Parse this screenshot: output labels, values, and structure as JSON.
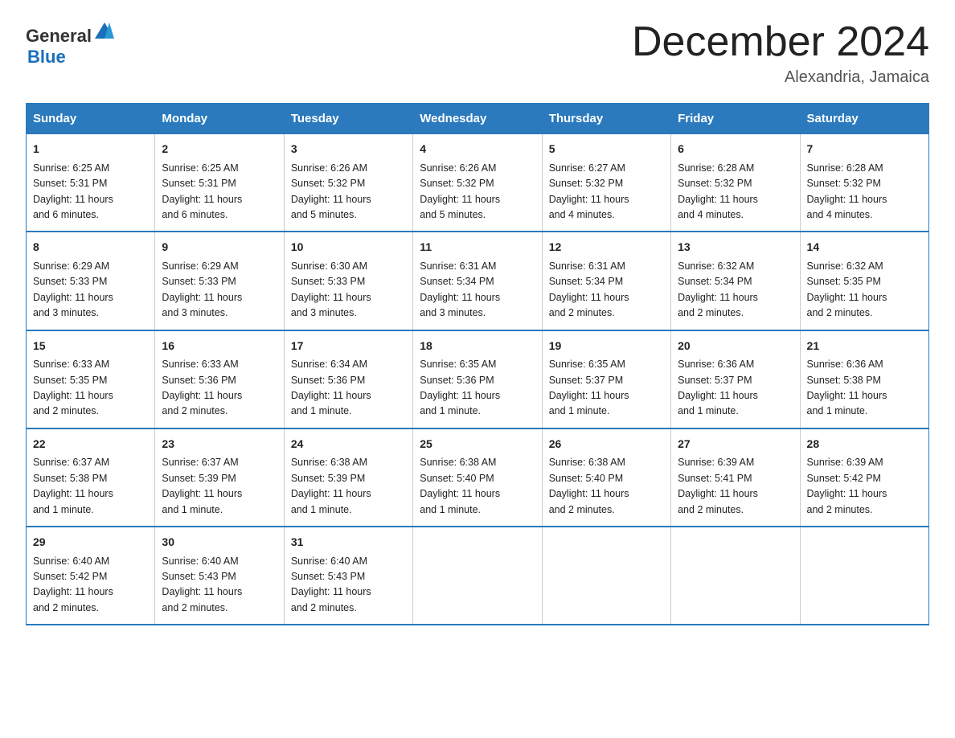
{
  "logo": {
    "text_general": "General",
    "text_blue": "Blue"
  },
  "header": {
    "month_year": "December 2024",
    "location": "Alexandria, Jamaica"
  },
  "days_of_week": [
    "Sunday",
    "Monday",
    "Tuesday",
    "Wednesday",
    "Thursday",
    "Friday",
    "Saturday"
  ],
  "weeks": [
    [
      {
        "day": "1",
        "sunrise": "6:25 AM",
        "sunset": "5:31 PM",
        "daylight": "11 hours and 6 minutes."
      },
      {
        "day": "2",
        "sunrise": "6:25 AM",
        "sunset": "5:31 PM",
        "daylight": "11 hours and 6 minutes."
      },
      {
        "day": "3",
        "sunrise": "6:26 AM",
        "sunset": "5:32 PM",
        "daylight": "11 hours and 5 minutes."
      },
      {
        "day": "4",
        "sunrise": "6:26 AM",
        "sunset": "5:32 PM",
        "daylight": "11 hours and 5 minutes."
      },
      {
        "day": "5",
        "sunrise": "6:27 AM",
        "sunset": "5:32 PM",
        "daylight": "11 hours and 4 minutes."
      },
      {
        "day": "6",
        "sunrise": "6:28 AM",
        "sunset": "5:32 PM",
        "daylight": "11 hours and 4 minutes."
      },
      {
        "day": "7",
        "sunrise": "6:28 AM",
        "sunset": "5:32 PM",
        "daylight": "11 hours and 4 minutes."
      }
    ],
    [
      {
        "day": "8",
        "sunrise": "6:29 AM",
        "sunset": "5:33 PM",
        "daylight": "11 hours and 3 minutes."
      },
      {
        "day": "9",
        "sunrise": "6:29 AM",
        "sunset": "5:33 PM",
        "daylight": "11 hours and 3 minutes."
      },
      {
        "day": "10",
        "sunrise": "6:30 AM",
        "sunset": "5:33 PM",
        "daylight": "11 hours and 3 minutes."
      },
      {
        "day": "11",
        "sunrise": "6:31 AM",
        "sunset": "5:34 PM",
        "daylight": "11 hours and 3 minutes."
      },
      {
        "day": "12",
        "sunrise": "6:31 AM",
        "sunset": "5:34 PM",
        "daylight": "11 hours and 2 minutes."
      },
      {
        "day": "13",
        "sunrise": "6:32 AM",
        "sunset": "5:34 PM",
        "daylight": "11 hours and 2 minutes."
      },
      {
        "day": "14",
        "sunrise": "6:32 AM",
        "sunset": "5:35 PM",
        "daylight": "11 hours and 2 minutes."
      }
    ],
    [
      {
        "day": "15",
        "sunrise": "6:33 AM",
        "sunset": "5:35 PM",
        "daylight": "11 hours and 2 minutes."
      },
      {
        "day": "16",
        "sunrise": "6:33 AM",
        "sunset": "5:36 PM",
        "daylight": "11 hours and 2 minutes."
      },
      {
        "day": "17",
        "sunrise": "6:34 AM",
        "sunset": "5:36 PM",
        "daylight": "11 hours and 1 minute."
      },
      {
        "day": "18",
        "sunrise": "6:35 AM",
        "sunset": "5:36 PM",
        "daylight": "11 hours and 1 minute."
      },
      {
        "day": "19",
        "sunrise": "6:35 AM",
        "sunset": "5:37 PM",
        "daylight": "11 hours and 1 minute."
      },
      {
        "day": "20",
        "sunrise": "6:36 AM",
        "sunset": "5:37 PM",
        "daylight": "11 hours and 1 minute."
      },
      {
        "day": "21",
        "sunrise": "6:36 AM",
        "sunset": "5:38 PM",
        "daylight": "11 hours and 1 minute."
      }
    ],
    [
      {
        "day": "22",
        "sunrise": "6:37 AM",
        "sunset": "5:38 PM",
        "daylight": "11 hours and 1 minute."
      },
      {
        "day": "23",
        "sunrise": "6:37 AM",
        "sunset": "5:39 PM",
        "daylight": "11 hours and 1 minute."
      },
      {
        "day": "24",
        "sunrise": "6:38 AM",
        "sunset": "5:39 PM",
        "daylight": "11 hours and 1 minute."
      },
      {
        "day": "25",
        "sunrise": "6:38 AM",
        "sunset": "5:40 PM",
        "daylight": "11 hours and 1 minute."
      },
      {
        "day": "26",
        "sunrise": "6:38 AM",
        "sunset": "5:40 PM",
        "daylight": "11 hours and 2 minutes."
      },
      {
        "day": "27",
        "sunrise": "6:39 AM",
        "sunset": "5:41 PM",
        "daylight": "11 hours and 2 minutes."
      },
      {
        "day": "28",
        "sunrise": "6:39 AM",
        "sunset": "5:42 PM",
        "daylight": "11 hours and 2 minutes."
      }
    ],
    [
      {
        "day": "29",
        "sunrise": "6:40 AM",
        "sunset": "5:42 PM",
        "daylight": "11 hours and 2 minutes."
      },
      {
        "day": "30",
        "sunrise": "6:40 AM",
        "sunset": "5:43 PM",
        "daylight": "11 hours and 2 minutes."
      },
      {
        "day": "31",
        "sunrise": "6:40 AM",
        "sunset": "5:43 PM",
        "daylight": "11 hours and 2 minutes."
      },
      null,
      null,
      null,
      null
    ]
  ],
  "labels": {
    "sunrise": "Sunrise:",
    "sunset": "Sunset:",
    "daylight": "Daylight:"
  }
}
